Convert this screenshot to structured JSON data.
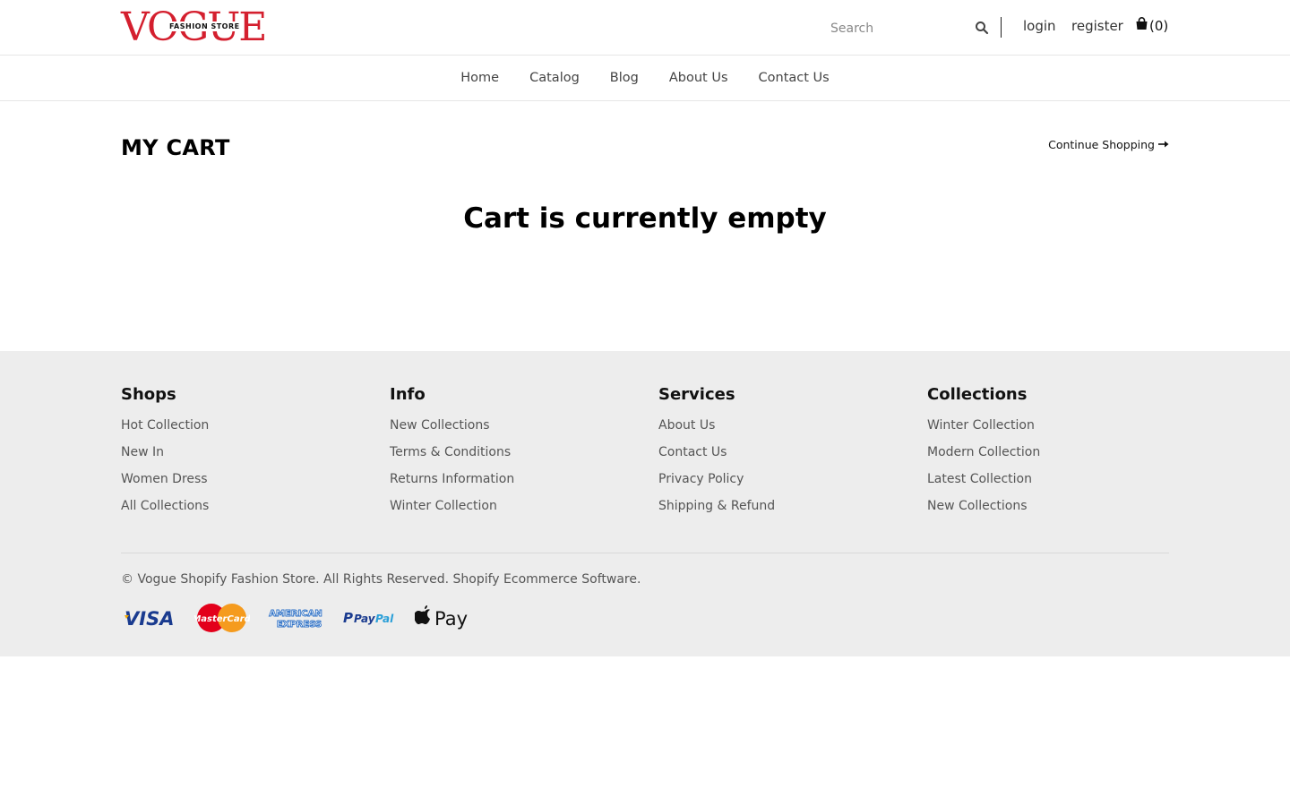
{
  "brand": {
    "logo_word": "VOGUE",
    "logo_sub": "FASHION STORE",
    "accent": "#d41f2e"
  },
  "header": {
    "search_placeholder": "Search",
    "login_label": "login",
    "register_label": "register",
    "cart_count": "(0)"
  },
  "nav": {
    "items": [
      "Home",
      "Catalog",
      "Blog",
      "About Us",
      "Contact Us"
    ]
  },
  "main": {
    "title": "MY CART",
    "continue_label": "Continue Shopping",
    "empty_message": "Cart is currently empty"
  },
  "footer": {
    "columns": [
      {
        "heading": "Shops",
        "links": [
          "Hot Collection",
          "New In",
          "Women Dress",
          "All Collections"
        ]
      },
      {
        "heading": "Info",
        "links": [
          "New Collections",
          "Terms & Conditions",
          "Returns Information",
          "Winter Collection"
        ]
      },
      {
        "heading": "Services",
        "links": [
          "About Us",
          "Contact Us",
          "Privacy Policy",
          "Shipping & Refund"
        ]
      },
      {
        "heading": "Collections",
        "links": [
          "Winter Collection",
          "Modern Collection",
          "Latest Collection",
          "New Collections"
        ]
      }
    ],
    "copyright": "© Vogue Shopify Fashion Store. All Rights Reserved. Shopify Ecommerce Software.",
    "payment_icons": [
      "visa-icon",
      "mastercard-icon",
      "american-express-icon",
      "paypal-icon",
      "apple-pay-icon"
    ],
    "background": "#ededed"
  }
}
